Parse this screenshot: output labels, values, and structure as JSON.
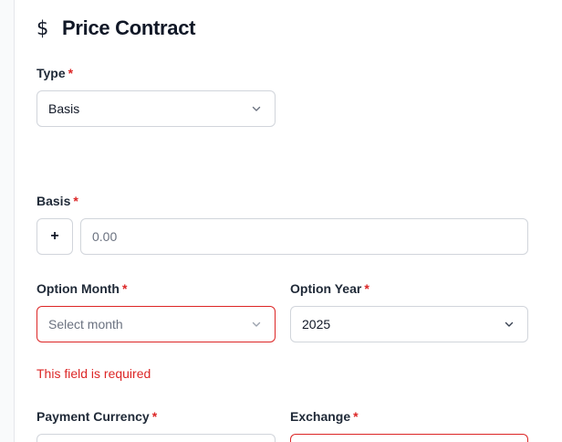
{
  "header": {
    "icon": "dollar-icon",
    "title": "Price Contract"
  },
  "required_marker": "*",
  "fields": {
    "type": {
      "label": "Type",
      "value": "Basis"
    },
    "basis": {
      "label": "Basis",
      "sign_button": "+",
      "placeholder": "0.00"
    },
    "option_month": {
      "label": "Option Month",
      "placeholder": "Select month",
      "error": "This field is required"
    },
    "option_year": {
      "label": "Option Year",
      "value": "2025"
    },
    "payment_currency": {
      "label": "Payment Currency"
    },
    "exchange": {
      "label": "Exchange"
    }
  },
  "colors": {
    "required": "#dc2626",
    "error": "#dc2626",
    "border": "#d1d5db"
  }
}
